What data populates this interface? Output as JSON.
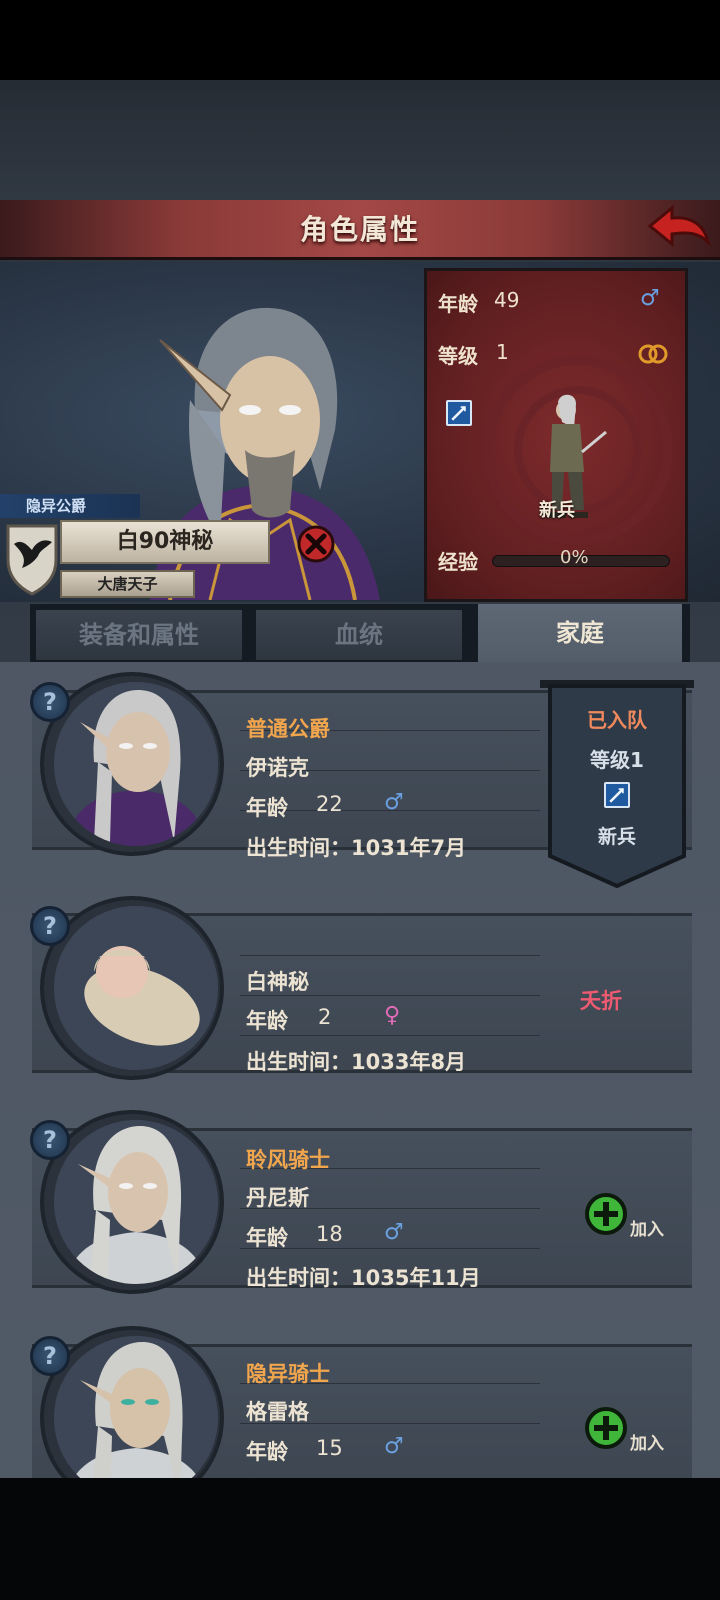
{
  "header": {
    "title": "角色属性"
  },
  "hero": {
    "title_tag": "隐异公爵",
    "name": "白90神秘",
    "subtitle": "大唐天子"
  },
  "stats": {
    "age_label": "年龄",
    "age_value": "49",
    "level_label": "等级",
    "level_value": "1",
    "unit_name": "新兵",
    "exp_label": "经验",
    "exp_percent": "0%",
    "exp_fraction": 0
  },
  "tabs": [
    {
      "label": "装备和属性",
      "active": false
    },
    {
      "label": "血统",
      "active": false
    },
    {
      "label": "家庭",
      "active": true
    }
  ],
  "family": [
    {
      "title": "普通公爵",
      "name": "伊诺克",
      "age_label": "年龄",
      "age": "22",
      "gender": "♂",
      "birth": "出生时间：1031年7月",
      "status": {
        "line1": "已入队",
        "line2": "等级1",
        "line3": "新兵"
      }
    },
    {
      "title": "",
      "name": "白神秘",
      "age_label": "年龄",
      "age": "2",
      "gender": "♀",
      "birth": "出生时间：1033年8月",
      "status_text": "夭折"
    },
    {
      "title": "聆风骑士",
      "name": "丹尼斯",
      "age_label": "年龄",
      "age": "18",
      "gender": "♂",
      "birth": "出生时间：1035年11月",
      "join_label": "加入"
    },
    {
      "title": "隐异骑士",
      "name": "格雷格",
      "age_label": "年龄",
      "age": "15",
      "gender": "♂",
      "join_label": "加入"
    }
  ],
  "help_glyph": "?",
  "colors": {
    "title_banner": "#a34846",
    "stats_panel": "#7e2b2c",
    "title_text": "#f1a54c",
    "male": "#6aa0e0",
    "female": "#e06cb6",
    "join": "#3fb53a"
  }
}
